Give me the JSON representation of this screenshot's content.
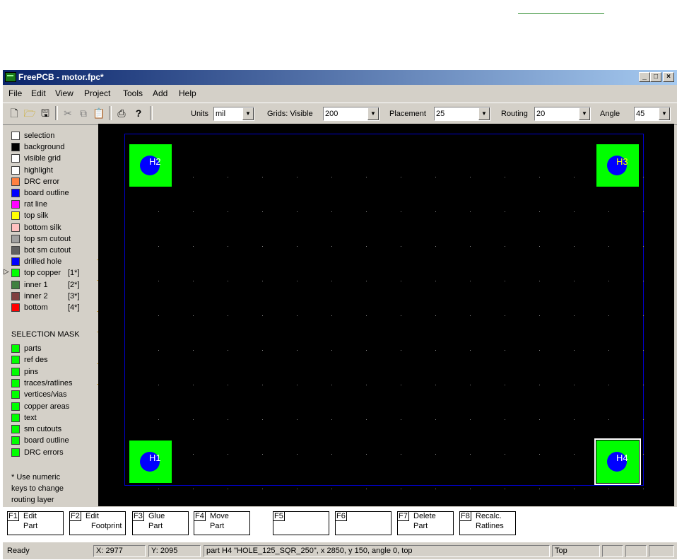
{
  "window": {
    "title": "FreePCB - motor.fpc*",
    "min": "_",
    "max": "□",
    "close": "×"
  },
  "menu": [
    "File",
    "Edit",
    "View",
    "Project",
    "Tools",
    "Add",
    "Help"
  ],
  "toolbar": {
    "icons": [
      "new-icon",
      "open-icon",
      "save-icon",
      "cut-icon",
      "copy-icon",
      "paste-icon",
      "print-icon",
      "help-icon"
    ],
    "units_label": "Units",
    "units_value": "mil",
    "grids_label": "Grids: Visible",
    "grids_value": "200",
    "placement_label": "Placement",
    "placement_value": "25",
    "routing_label": "Routing",
    "routing_value": "20",
    "angle_label": "Angle",
    "angle_value": "45"
  },
  "layers": [
    {
      "label": "selection",
      "color": "#ffffff",
      "num": ""
    },
    {
      "label": "background",
      "color": "#000000",
      "num": ""
    },
    {
      "label": "visible grid",
      "color": "#ffffff",
      "num": ""
    },
    {
      "label": "highlight",
      "color": "#ffffff",
      "num": ""
    },
    {
      "label": "DRC error",
      "color": "#ff8040",
      "num": ""
    },
    {
      "label": "board outline",
      "color": "#0000ff",
      "num": ""
    },
    {
      "label": "rat line",
      "color": "#ff00ff",
      "num": ""
    },
    {
      "label": "top silk",
      "color": "#ffff00",
      "num": ""
    },
    {
      "label": "bottom silk",
      "color": "#ffc0c0",
      "num": ""
    },
    {
      "label": "top sm cutout",
      "color": "#a0a0a0",
      "num": ""
    },
    {
      "label": "bot sm cutout",
      "color": "#606060",
      "num": ""
    },
    {
      "label": "drilled hole",
      "color": "#0000ff",
      "num": ""
    },
    {
      "label": "top copper",
      "color": "#00ff00",
      "num": "[1*]"
    },
    {
      "label": "inner 1",
      "color": "#408040",
      "num": "[2*]"
    },
    {
      "label": "inner 2",
      "color": "#804040",
      "num": "[3*]"
    },
    {
      "label": "bottom",
      "color": "#ff0000",
      "num": "[4*]"
    }
  ],
  "selection_mask_title": "SELECTION MASK",
  "selection_mask": [
    "parts",
    "ref des",
    "pins",
    "traces/ratlines",
    "vertices/vias",
    "copper areas",
    "text",
    "sm cutouts",
    "board outline",
    "DRC errors"
  ],
  "mask_color": "#00ff00",
  "note": [
    "* Use numeric",
    "keys to change",
    "routing layer"
  ],
  "parts": [
    {
      "ref": "H2",
      "pos": "tl"
    },
    {
      "ref": "H3",
      "pos": "tr"
    },
    {
      "ref": "H1",
      "pos": "bl"
    },
    {
      "ref": "H4",
      "pos": "br"
    }
  ],
  "fkeys": [
    {
      "key": "F1",
      "l1": "Edit",
      "l2": "Part"
    },
    {
      "key": "F2",
      "l1": "Edit",
      "l2": "Footprint"
    },
    {
      "key": "F3",
      "l1": "Glue",
      "l2": "Part"
    },
    {
      "key": "F4",
      "l1": "Move",
      "l2": "Part"
    },
    {
      "key": "F5",
      "l1": "",
      "l2": ""
    },
    {
      "key": "F6",
      "l1": "",
      "l2": ""
    },
    {
      "key": "F7",
      "l1": "Delete",
      "l2": "Part"
    },
    {
      "key": "F8",
      "l1": "Recalc.",
      "l2": "Ratlines"
    }
  ],
  "status": {
    "ready": "Ready",
    "x": "X: 2977",
    "y": "Y: 2095",
    "info": "part H4 \"HOLE_125_SQR_250\", x 2850, y 150, angle 0, top",
    "layer": "Top"
  }
}
